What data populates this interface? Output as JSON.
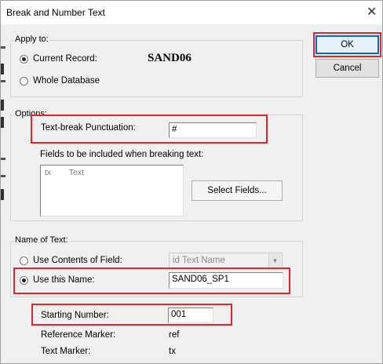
{
  "dialog": {
    "title": "Break and Number Text",
    "close_glyph": "✕"
  },
  "apply_to": {
    "group_label": "Apply to:",
    "current_record_label": "Current Record:",
    "current_record_value": "SAND06",
    "whole_database_label": "Whole Database",
    "selected": "current_record"
  },
  "buttons": {
    "ok": "OK",
    "cancel": "Cancel",
    "select_fields": "Select Fields..."
  },
  "options": {
    "group_label": "Options:",
    "punctuation_label": "Text-break Punctuation:",
    "punctuation_value": "#",
    "fields_label": "Fields to be included when breaking text:",
    "fields": [
      {
        "marker": "tx",
        "name": "Text"
      }
    ]
  },
  "name_of_text": {
    "group_label": "Name of Text:",
    "use_contents_label": "Use Contents of Field:",
    "contents_field_value": "id  Text Name",
    "use_name_label": "Use this Name:",
    "use_name_value": "SAND06_SP1",
    "selected": "use_this_name"
  },
  "numbering": {
    "starting_number_label": "Starting Number:",
    "starting_number_value": "001",
    "reference_marker_label": "Reference Marker:",
    "reference_marker_value": "ref",
    "text_marker_label": "Text Marker:",
    "text_marker_value": "tx"
  },
  "colors": {
    "highlight": "#e0262b",
    "dialog_bg": "#f0f0f0"
  }
}
